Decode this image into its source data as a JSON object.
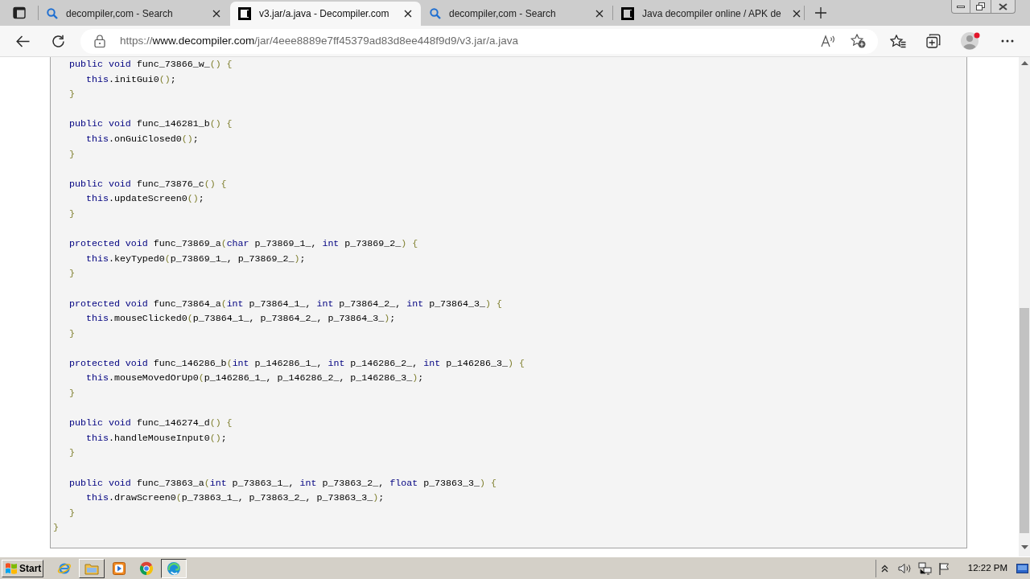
{
  "tabs": [
    {
      "kind": "search",
      "title": "decompiler,com - Search",
      "selected": false
    },
    {
      "kind": "site",
      "title": "v3.jar/a.java - Decompiler.com",
      "selected": true
    },
    {
      "kind": "search",
      "title": "decompiler,com - Search",
      "selected": false
    },
    {
      "kind": "site",
      "title": "Java decompiler online / APK de",
      "selected": false
    }
  ],
  "address_bar": {
    "scheme": "https://",
    "host": "www.decompiler.com",
    "path": "/jar/4eee8889e7ff45379ad83d8ee448f9d9/v3.jar/a.java"
  },
  "code": {
    "methods": [
      {
        "header": [
          {
            "kind": "keyword",
            "text": "public void"
          },
          {
            "kind": "name",
            "text": " func_73866_w_"
          },
          {
            "kind": "bracket",
            "text": "() {"
          }
        ],
        "body": [
          [
            {
              "kind": "keyword",
              "text": "this"
            },
            {
              "kind": "name",
              "text": ".initGui0"
            },
            {
              "kind": "bracket",
              "text": "()"
            },
            {
              "kind": "name",
              "text": ";"
            }
          ]
        ],
        "footer": [
          {
            "kind": "bracket",
            "text": "}"
          }
        ]
      },
      {
        "header": [
          {
            "kind": "keyword",
            "text": "public void"
          },
          {
            "kind": "name",
            "text": " func_146281_b"
          },
          {
            "kind": "bracket",
            "text": "() {"
          }
        ],
        "body": [
          [
            {
              "kind": "keyword",
              "text": "this"
            },
            {
              "kind": "name",
              "text": ".onGuiClosed0"
            },
            {
              "kind": "bracket",
              "text": "()"
            },
            {
              "kind": "name",
              "text": ";"
            }
          ]
        ],
        "footer": [
          {
            "kind": "bracket",
            "text": "}"
          }
        ]
      },
      {
        "header": [
          {
            "kind": "keyword",
            "text": "public void"
          },
          {
            "kind": "name",
            "text": " func_73876_c"
          },
          {
            "kind": "bracket",
            "text": "() {"
          }
        ],
        "body": [
          [
            {
              "kind": "keyword",
              "text": "this"
            },
            {
              "kind": "name",
              "text": ".updateScreen0"
            },
            {
              "kind": "bracket",
              "text": "()"
            },
            {
              "kind": "name",
              "text": ";"
            }
          ]
        ],
        "footer": [
          {
            "kind": "bracket",
            "text": "}"
          }
        ]
      },
      {
        "header": [
          {
            "kind": "keyword",
            "text": "protected void"
          },
          {
            "kind": "name",
            "text": " func_73869_a"
          },
          {
            "kind": "bracket",
            "text": "("
          },
          {
            "kind": "keyword",
            "text": "char"
          },
          {
            "kind": "name",
            "text": " p_73869_1_, "
          },
          {
            "kind": "keyword",
            "text": "int"
          },
          {
            "kind": "name",
            "text": " p_73869_2_"
          },
          {
            "kind": "bracket",
            "text": ") {"
          }
        ],
        "body": [
          [
            {
              "kind": "keyword",
              "text": "this"
            },
            {
              "kind": "name",
              "text": ".keyTyped0"
            },
            {
              "kind": "bracket",
              "text": "("
            },
            {
              "kind": "name",
              "text": "p_73869_1_, p_73869_2_"
            },
            {
              "kind": "bracket",
              "text": ")"
            },
            {
              "kind": "name",
              "text": ";"
            }
          ]
        ],
        "footer": [
          {
            "kind": "bracket",
            "text": "}"
          }
        ]
      },
      {
        "header": [
          {
            "kind": "keyword",
            "text": "protected void"
          },
          {
            "kind": "name",
            "text": " func_73864_a"
          },
          {
            "kind": "bracket",
            "text": "("
          },
          {
            "kind": "keyword",
            "text": "int"
          },
          {
            "kind": "name",
            "text": " p_73864_1_, "
          },
          {
            "kind": "keyword",
            "text": "int"
          },
          {
            "kind": "name",
            "text": " p_73864_2_, "
          },
          {
            "kind": "keyword",
            "text": "int"
          },
          {
            "kind": "name",
            "text": " p_73864_3_"
          },
          {
            "kind": "bracket",
            "text": ") {"
          }
        ],
        "body": [
          [
            {
              "kind": "keyword",
              "text": "this"
            },
            {
              "kind": "name",
              "text": ".mouseClicked0"
            },
            {
              "kind": "bracket",
              "text": "("
            },
            {
              "kind": "name",
              "text": "p_73864_1_, p_73864_2_, p_73864_3_"
            },
            {
              "kind": "bracket",
              "text": ")"
            },
            {
              "kind": "name",
              "text": ";"
            }
          ]
        ],
        "footer": [
          {
            "kind": "bracket",
            "text": "}"
          }
        ]
      },
      {
        "header": [
          {
            "kind": "keyword",
            "text": "protected void"
          },
          {
            "kind": "name",
            "text": " func_146286_b"
          },
          {
            "kind": "bracket",
            "text": "("
          },
          {
            "kind": "keyword",
            "text": "int"
          },
          {
            "kind": "name",
            "text": " p_146286_1_, "
          },
          {
            "kind": "keyword",
            "text": "int"
          },
          {
            "kind": "name",
            "text": " p_146286_2_, "
          },
          {
            "kind": "keyword",
            "text": "int"
          },
          {
            "kind": "name",
            "text": " p_146286_3_"
          },
          {
            "kind": "bracket",
            "text": ") {"
          }
        ],
        "body": [
          [
            {
              "kind": "keyword",
              "text": "this"
            },
            {
              "kind": "name",
              "text": ".mouseMovedOrUp0"
            },
            {
              "kind": "bracket",
              "text": "("
            },
            {
              "kind": "name",
              "text": "p_146286_1_, p_146286_2_, p_146286_3_"
            },
            {
              "kind": "bracket",
              "text": ")"
            },
            {
              "kind": "name",
              "text": ";"
            }
          ]
        ],
        "footer": [
          {
            "kind": "bracket",
            "text": "}"
          }
        ]
      },
      {
        "header": [
          {
            "kind": "keyword",
            "text": "public void"
          },
          {
            "kind": "name",
            "text": " func_146274_d"
          },
          {
            "kind": "bracket",
            "text": "() {"
          }
        ],
        "body": [
          [
            {
              "kind": "keyword",
              "text": "this"
            },
            {
              "kind": "name",
              "text": ".handleMouseInput0"
            },
            {
              "kind": "bracket",
              "text": "()"
            },
            {
              "kind": "name",
              "text": ";"
            }
          ]
        ],
        "footer": [
          {
            "kind": "bracket",
            "text": "}"
          }
        ]
      },
      {
        "header": [
          {
            "kind": "keyword",
            "text": "public void"
          },
          {
            "kind": "name",
            "text": " func_73863_a"
          },
          {
            "kind": "bracket",
            "text": "("
          },
          {
            "kind": "keyword",
            "text": "int"
          },
          {
            "kind": "name",
            "text": " p_73863_1_, "
          },
          {
            "kind": "keyword",
            "text": "int"
          },
          {
            "kind": "name",
            "text": " p_73863_2_, "
          },
          {
            "kind": "keyword",
            "text": "float"
          },
          {
            "kind": "name",
            "text": " p_73863_3_"
          },
          {
            "kind": "bracket",
            "text": ") {"
          }
        ],
        "body": [
          [
            {
              "kind": "keyword",
              "text": "this"
            },
            {
              "kind": "name",
              "text": ".drawScreen0"
            },
            {
              "kind": "bracket",
              "text": "("
            },
            {
              "kind": "name",
              "text": "p_73863_1_, p_73863_2_, p_73863_3_"
            },
            {
              "kind": "bracket",
              "text": ")"
            },
            {
              "kind": "name",
              "text": ";"
            }
          ]
        ],
        "footer": [
          {
            "kind": "bracket",
            "text": "}"
          }
        ]
      }
    ],
    "closing": [
      {
        "kind": "bracket",
        "text": "}"
      }
    ]
  },
  "taskbar": {
    "start": "Start",
    "apps": [
      {
        "open": false,
        "selected": false
      },
      {
        "open": true,
        "selected": false
      },
      {
        "open": false,
        "selected": false
      },
      {
        "open": false,
        "selected": false
      },
      {
        "open": true,
        "selected": true
      }
    ],
    "clock": "12:22 PM"
  }
}
